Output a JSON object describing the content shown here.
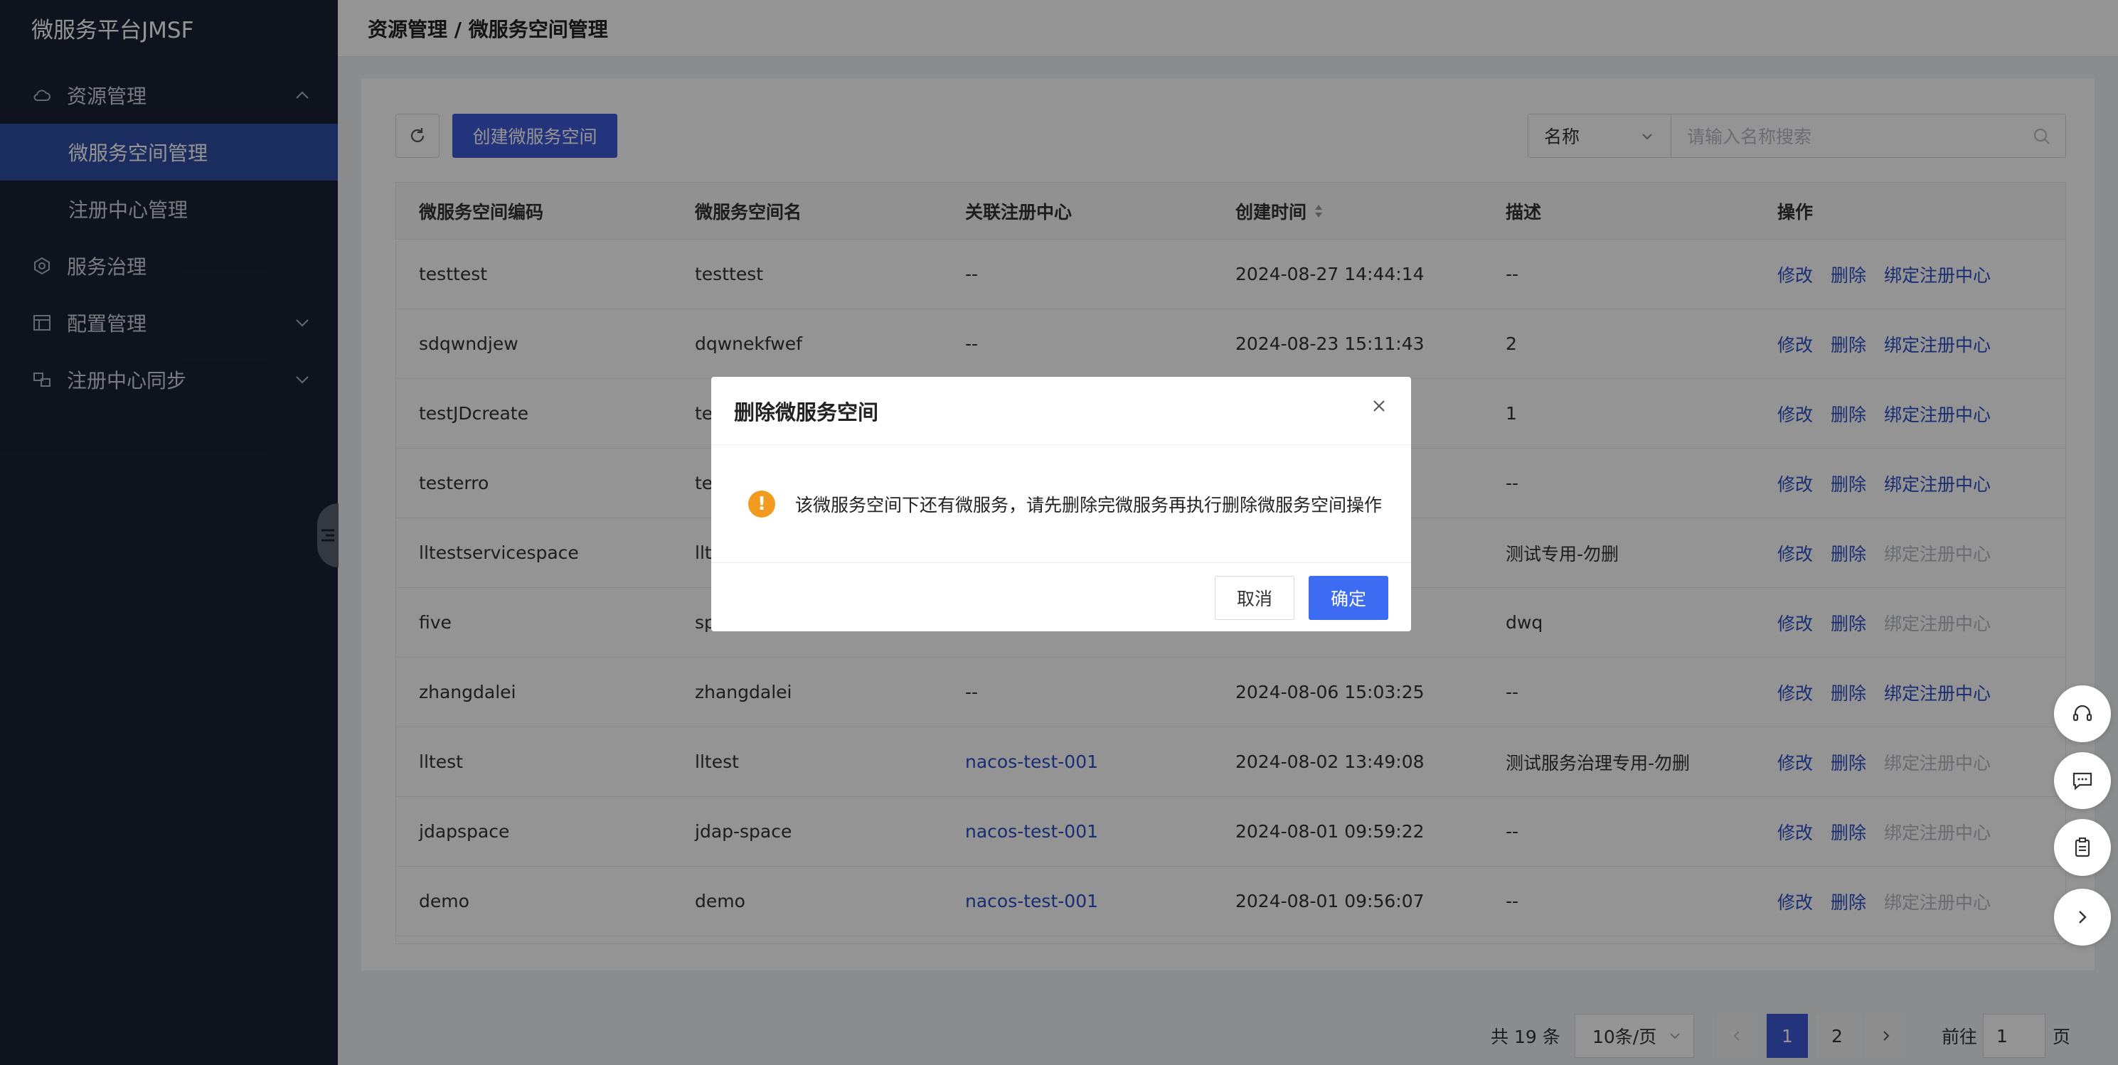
{
  "sidebar": {
    "brand": "微服务平台JMSF",
    "menu": [
      {
        "label": "资源管理",
        "icon": "cloud-icon",
        "expanded": true
      },
      {
        "label": "服务治理",
        "icon": "hexagon-icon"
      },
      {
        "label": "配置管理",
        "icon": "config-icon"
      },
      {
        "label": "注册中心同步",
        "icon": "sync-icon"
      }
    ],
    "submenu": [
      {
        "label": "微服务空间管理",
        "active": true
      },
      {
        "label": "注册中心管理"
      }
    ]
  },
  "header": {
    "breadcrumb": "资源管理 / 微服务空间管理"
  },
  "toolbar": {
    "create_label": "创建微服务空间",
    "search_select": "名称",
    "search_placeholder": "请输入名称搜索"
  },
  "table": {
    "columns": [
      "微服务空间编码",
      "微服务空间名",
      "关联注册中心",
      "创建时间",
      "描述",
      "操作"
    ],
    "rows": [
      {
        "code": "testtest",
        "name": "testtest",
        "registry": "--",
        "created": "2024-08-27 14:44:14",
        "desc": "--",
        "bind_enabled": true
      },
      {
        "code": "sdqwndjew",
        "name": "dqwnekfwef",
        "registry": "--",
        "created": "2024-08-23 15:11:43",
        "desc": "2",
        "bind_enabled": true
      },
      {
        "code": "testJDcreate",
        "name": "te",
        "registry": "",
        "created": "",
        "desc": "1",
        "bind_enabled": true
      },
      {
        "code": "testerro",
        "name": "te",
        "registry": "",
        "created": "",
        "desc": "--",
        "bind_enabled": true
      },
      {
        "code": "lltestservicespace",
        "name": "llt",
        "registry": "",
        "created": "",
        "desc": "测试专用-勿删",
        "bind_enabled": false
      },
      {
        "code": "five",
        "name": "sp",
        "registry": "",
        "created": "",
        "desc": "dwq",
        "bind_enabled": false
      },
      {
        "code": "zhangdalei",
        "name": "zhangdalei",
        "registry": "--",
        "created": "2024-08-06 15:03:25",
        "desc": "--",
        "bind_enabled": true
      },
      {
        "code": "lltest",
        "name": "lltest",
        "registry": "nacos-test-001",
        "created": "2024-08-02 13:49:08",
        "desc": "测试服务治理专用-勿删",
        "bind_enabled": false
      },
      {
        "code": "jdapspace",
        "name": "jdap-space",
        "registry": "nacos-test-001",
        "created": "2024-08-01 09:59:22",
        "desc": "--",
        "bind_enabled": false
      },
      {
        "code": "demo",
        "name": "demo",
        "registry": "nacos-test-001",
        "created": "2024-08-01 09:56:07",
        "desc": "--",
        "bind_enabled": false
      }
    ],
    "actions": {
      "edit": "修改",
      "delete": "删除",
      "bind": "绑定注册中心"
    }
  },
  "pagination": {
    "total": "共 19 条",
    "page_size": "10条/页",
    "pages": [
      "1",
      "2"
    ],
    "current": "1",
    "goto_prefix": "前往",
    "goto_value": "1",
    "goto_suffix": "页"
  },
  "modal": {
    "title": "删除微服务空间",
    "message": "该微服务空间下还有微服务，请先删除完微服务再执行删除微服务空间操作",
    "cancel": "取消",
    "ok": "确定"
  },
  "colors": {
    "primary": "#3d5bd6",
    "sidebar": "#1b2234",
    "warning": "#f29b1f"
  }
}
